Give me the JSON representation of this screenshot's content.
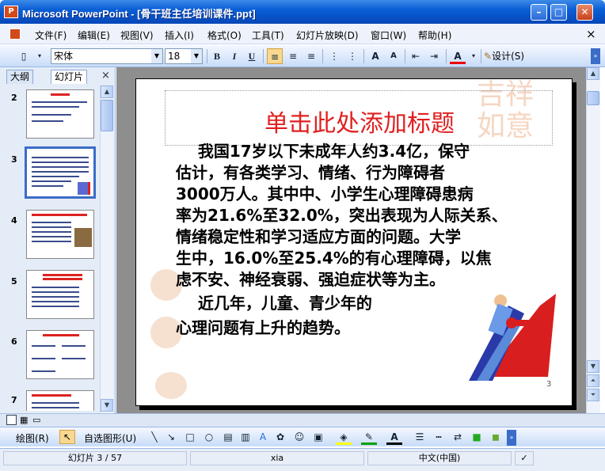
{
  "window": {
    "title": "Microsoft PowerPoint - [骨干班主任培训课件.ppt]",
    "app_icon": "P"
  },
  "menu": {
    "items": [
      "文件(F)",
      "编辑(E)",
      "视图(V)",
      "插入(I)",
      "格式(O)",
      "工具(T)",
      "幻灯片放映(D)",
      "窗口(W)",
      "帮助(H)"
    ],
    "close_glyph": "×"
  },
  "toolbar": {
    "font_name": "宋体",
    "font_size": "18",
    "bold": "B",
    "italic": "I",
    "underline": "U",
    "design_label": "设计(S)"
  },
  "panel": {
    "tab_outline": "大纲",
    "tab_slides": "幻灯片",
    "close_glyph": "×",
    "slide_numbers": [
      "2",
      "3",
      "4",
      "5",
      "6",
      "7"
    ]
  },
  "slide": {
    "title": "单击此处添加标题",
    "body_lines": [
      "    我国17岁以下未成年人约3.4亿，保守",
      "估计，有各类学习、情绪、行为障碍者",
      "3000万人。其中中、小学生心理障碍患病",
      "率为21.6%至32.0%，突出表现为人际关系、",
      "情绪稳定性和学习适应方面的问题。大学",
      "生中，16.0%至25.4%的有心理障碍，以焦",
      "虑不安、神经衰弱、强迫症状等为主。"
    ],
    "para2_lines": [
      "    近几年，儿童、青少年的",
      "心理问题有上升的趋势。"
    ],
    "number": "3"
  },
  "drawbar": {
    "draw_label": "绘图(R)",
    "autoshape_label": "自选图形(U)"
  },
  "status": {
    "slide_info": "幻灯片 3 / 57",
    "template": "xia",
    "language": "中文(中国)"
  },
  "colors": {
    "title_red": "#e02020",
    "titlebar_blue": "#0a5fd6"
  }
}
